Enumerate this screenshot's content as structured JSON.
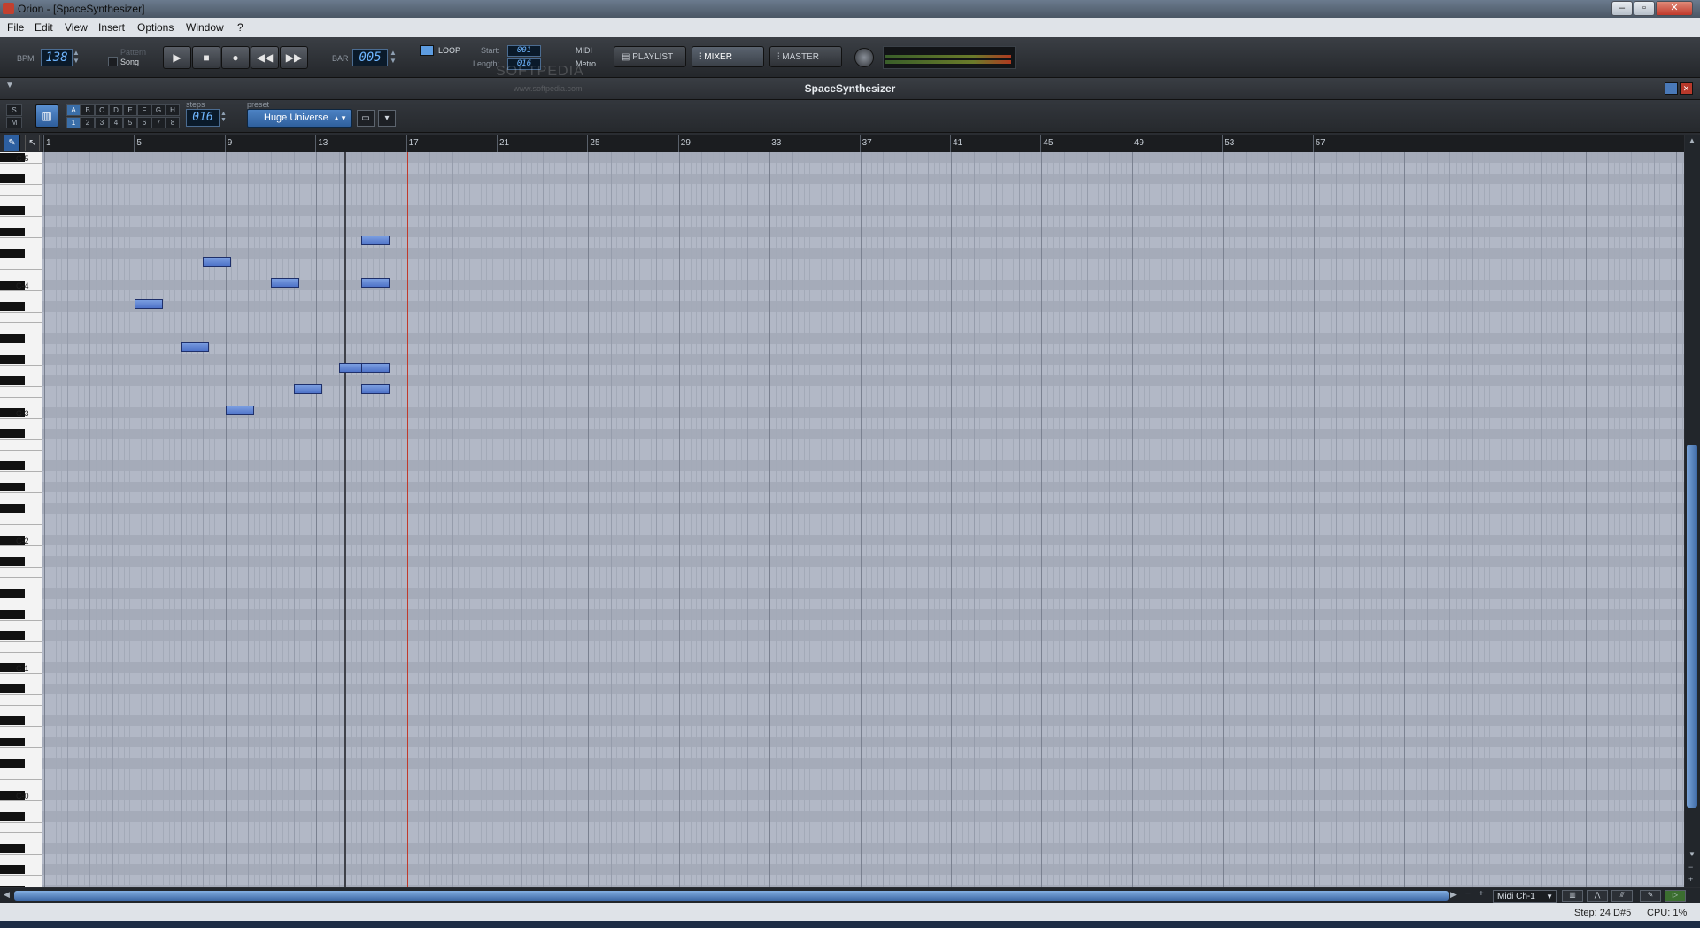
{
  "window": {
    "title": "Orion - [SpaceSynthesizer]"
  },
  "menu": [
    "File",
    "Edit",
    "View",
    "Insert",
    "Options",
    "Window",
    "?"
  ],
  "transport": {
    "bpm_label": "BPM",
    "bpm": "138",
    "pattern_label": "Pattern",
    "song_label": "Song",
    "bar_label": "BAR",
    "bar": "005",
    "loop_label": "LOOP",
    "start_label": "Start:",
    "start": "001",
    "length_label": "Length:",
    "length": "016",
    "midi_label": "MIDI",
    "metro_label": "Metro",
    "playlist": "PLAYLIST",
    "mixer": "MIXER",
    "master": "MASTER"
  },
  "watermark": {
    "name": "SOFTPEDIA",
    "url": "www.softpedia.com"
  },
  "instrument": {
    "title": "SpaceSynthesizer"
  },
  "toolbar": {
    "s": "S",
    "m": "M",
    "pattern_letters": [
      "A",
      "B",
      "C",
      "D",
      "E",
      "F",
      "G",
      "H"
    ],
    "pattern_numbers": [
      "1",
      "2",
      "3",
      "4",
      "5",
      "6",
      "7",
      "8"
    ],
    "steps_label": "steps",
    "steps": "016",
    "preset_label": "preset",
    "preset": "Huge Universe"
  },
  "ruler": [
    "1",
    "5",
    "9",
    "13",
    "17",
    "21",
    "25",
    "29",
    "33",
    "37",
    "41",
    "45",
    "49",
    "53",
    "57"
  ],
  "keyboard_labels": [
    "C-5",
    "C-4",
    "C-3",
    "C-2",
    "C-1",
    "C-0"
  ],
  "notes": [
    {
      "bar": 5.0,
      "row": 7,
      "len": 1
    },
    {
      "bar": 8.0,
      "row": 5,
      "len": 1
    },
    {
      "bar": 7.0,
      "row": 9,
      "len": 1
    },
    {
      "bar": 11.0,
      "row": 6,
      "len": 1
    },
    {
      "bar": 9.0,
      "row": 12,
      "len": 1
    },
    {
      "bar": 12.0,
      "row": 11,
      "len": 1
    },
    {
      "bar": 14.0,
      "row": 10,
      "len": 1
    },
    {
      "bar": 15.0,
      "row": 4,
      "len": 1
    },
    {
      "bar": 15.0,
      "row": 6,
      "len": 1
    },
    {
      "bar": 15.0,
      "row": 10,
      "len": 1
    },
    {
      "bar": 15.0,
      "row": 11,
      "len": 1
    }
  ],
  "playhead_bar": 14.25,
  "loop_end_bar": 17,
  "bottom": {
    "midi_channel": "Midi Ch-1"
  },
  "status": {
    "step": "Step: 24  D#5",
    "cpu": "CPU: 1%"
  }
}
